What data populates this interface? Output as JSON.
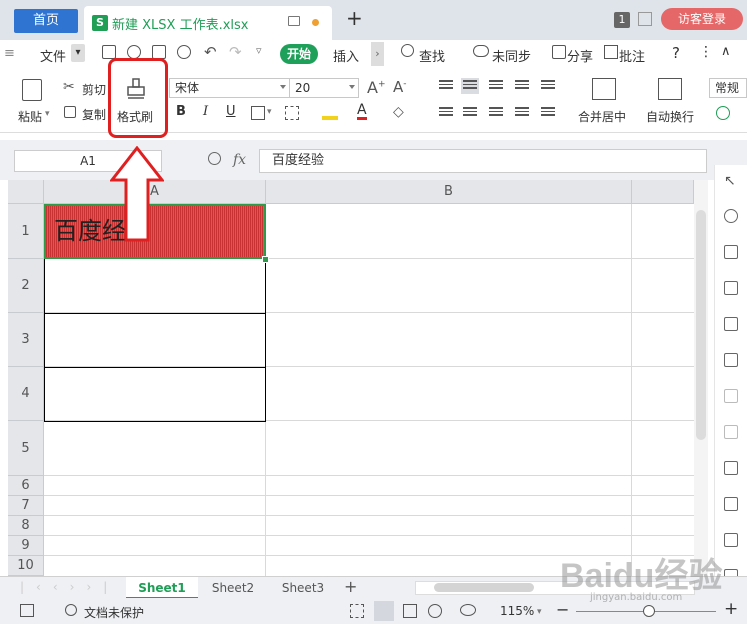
{
  "tabbar": {
    "home_tab": "首页",
    "doc_tab_icon": "S",
    "doc_tab_title": "新建 XLSX 工作表.xlsx",
    "new_tab": "+",
    "window_count": "1",
    "login_button": "访客登录"
  },
  "menu": {
    "file": "文件",
    "start": "开始",
    "insert": "插入",
    "search": "查找",
    "sync": "未同步",
    "share": "分享",
    "comment": "批注",
    "help": "?"
  },
  "ribbon": {
    "paste": "粘贴",
    "cut": "剪切",
    "copy": "复制",
    "format_painter": "格式刷",
    "font_name": "宋体",
    "font_size": "20",
    "bold": "B",
    "italic": "I",
    "underline": "U",
    "merge_center": "合并居中",
    "wrap_text": "自动换行",
    "number_format": "常规",
    "font_grow": "A+",
    "font_shrink": "A-"
  },
  "formula_bar": {
    "name_box": "A1",
    "fx": "fx",
    "content": "百度经验"
  },
  "grid": {
    "columns": [
      "A",
      "B"
    ],
    "rows": [
      "1",
      "2",
      "3",
      "4",
      "5",
      "6",
      "7",
      "8",
      "9",
      "10"
    ],
    "cell_a1": "百度经验"
  },
  "sheets": {
    "tabs": [
      "Sheet1",
      "Sheet2",
      "Sheet3"
    ],
    "active": "Sheet1",
    "add": "+"
  },
  "status": {
    "protection": "文档未保护",
    "zoom": "115%",
    "zoom_minus": "−",
    "zoom_plus": "+"
  },
  "watermark": {
    "brand": "Baidu经验",
    "url": "jingyan.baidu.com"
  },
  "colors": {
    "accent_green": "#1f9e56",
    "home_blue": "#2f74d0",
    "highlight_red": "#e02020",
    "login_red": "#e56767"
  }
}
